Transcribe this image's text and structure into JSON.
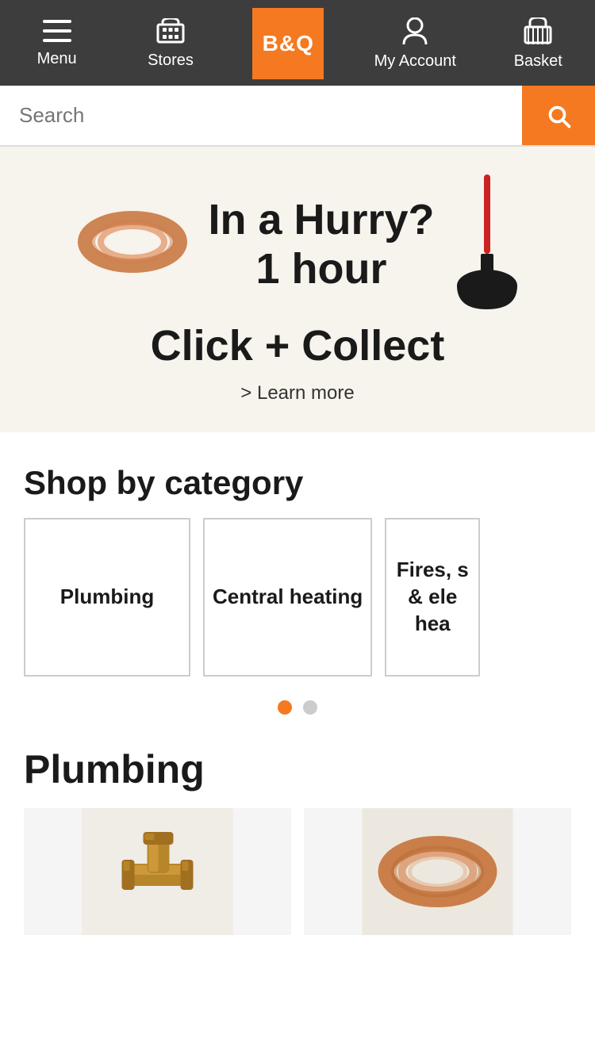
{
  "header": {
    "menu_label": "Menu",
    "stores_label": "Stores",
    "logo_text": "B&Q",
    "account_label": "My Account",
    "basket_label": "Basket"
  },
  "search": {
    "placeholder": "Search"
  },
  "hero": {
    "line1": "In a Hurry?",
    "line2": "1 hour",
    "line3": "Click + Collect",
    "learn_more": "> Learn more"
  },
  "shop_by_category": {
    "title": "Shop by category",
    "categories": [
      {
        "name": "Plumbing"
      },
      {
        "name": "Central heating"
      },
      {
        "name": "Fires, s & ele hea..."
      }
    ],
    "partial_label": "Fires, s\n& ele\nhea"
  },
  "plumbing_section": {
    "title": "Plumbing",
    "products": [
      {
        "name": "pipe-fitting"
      },
      {
        "name": "copper-coil"
      }
    ]
  },
  "dots": {
    "active": 0,
    "total": 2
  }
}
